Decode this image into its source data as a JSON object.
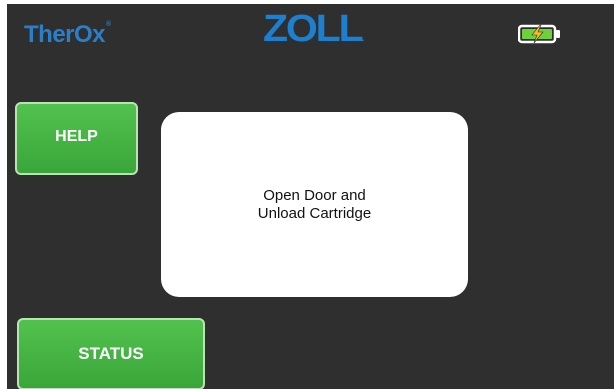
{
  "header": {
    "brand_left": "TherOx",
    "brand_left_mark": "®",
    "brand_center": "ZOLL",
    "brand_center_mark": ".",
    "battery_icon": "battery-charging-icon",
    "battery_color": "#6dd13a",
    "bolt_color": "#f3c21a"
  },
  "buttons": {
    "help_label": "HELP",
    "status_label": "STATUS"
  },
  "message": {
    "line1": "Open Door and",
    "line2": "Unload Cartridge"
  },
  "colors": {
    "background": "#2f2f2f",
    "brand_blue": "#1c7fd0",
    "button_green": "#45b442",
    "panel": "#ffffff"
  }
}
